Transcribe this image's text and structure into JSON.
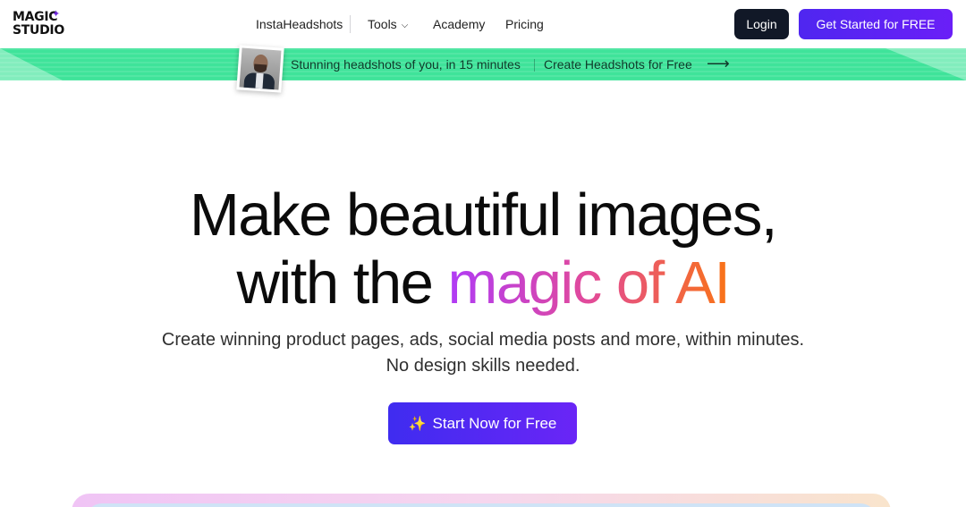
{
  "header": {
    "logo_line1": "MAGIC",
    "logo_line2": "STUDIO",
    "nav": {
      "instaheadshots": "InstaHeadshots",
      "tools": "Tools",
      "academy": "Academy",
      "pricing": "Pricing"
    },
    "login_label": "Login",
    "get_started_label": "Get Started for FREE"
  },
  "banner": {
    "text": "Stunning headshots of you, in 15 minutes",
    "link": "Create Headshots for Free",
    "color": "#3fe39a"
  },
  "hero": {
    "line1": "Make beautiful images,",
    "line2_prefix": "with the ",
    "line2_highlight": "magic of AI",
    "subtitle_line1": "Create winning product pages, ads, social media posts and more, within minutes.",
    "subtitle_line2": "No design skills needed.",
    "cta_label": "Start Now for Free"
  },
  "colors": {
    "primary": "#5b21f5",
    "dark_button": "#111827",
    "gradient_start": "#b03bf6",
    "gradient_end": "#f97316"
  },
  "icons": {
    "logo_spark": "sparkle-icon",
    "tools_chevron": "chevron-down-icon",
    "banner_arrow": "arrow-right-icon",
    "cta_spark": "sparkles-icon"
  }
}
